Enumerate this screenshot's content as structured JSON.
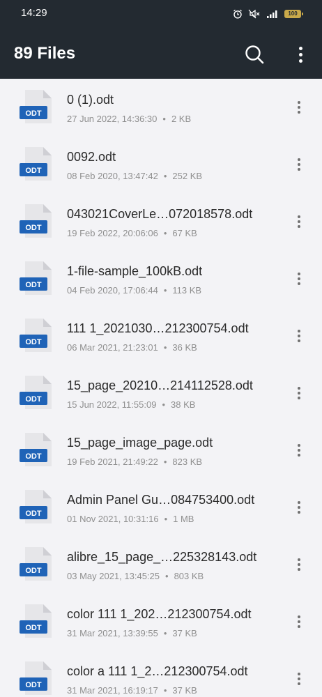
{
  "status_bar": {
    "time": "14:29",
    "battery": "100",
    "icons": [
      "alarm-icon",
      "mute-icon",
      "signal-icon",
      "battery-icon"
    ]
  },
  "header": {
    "title": "89 Files",
    "search_icon": "search-icon",
    "menu_icon": "overflow-menu-icon"
  },
  "file_badge": "ODT",
  "files": [
    {
      "name": "0 (1).odt",
      "date": "27 Jun 2022, 14:36:30",
      "size": "2 KB"
    },
    {
      "name": "0092.odt",
      "date": "08 Feb 2020, 13:47:42",
      "size": "252 KB"
    },
    {
      "name": "043021CoverLe…072018578.odt",
      "date": "19 Feb 2022, 20:06:06",
      "size": "67 KB"
    },
    {
      "name": "1-file-sample_100kB.odt",
      "date": "04 Feb 2020, 17:06:44",
      "size": "113 KB"
    },
    {
      "name": "111 1_2021030…212300754.odt",
      "date": "06 Mar 2021, 21:23:01",
      "size": "36 KB"
    },
    {
      "name": "15_page_20210…214112528.odt",
      "date": "15 Jun 2022, 11:55:09",
      "size": "38 KB"
    },
    {
      "name": "15_page_image_page.odt",
      "date": "19 Feb 2021, 21:49:22",
      "size": "823 KB"
    },
    {
      "name": "Admin Panel Gu…084753400.odt",
      "date": "01 Nov 2021, 10:31:16",
      "size": "1 MB"
    },
    {
      "name": "alibre_15_page_…225328143.odt",
      "date": "03 May 2021, 13:45:25",
      "size": "803 KB"
    },
    {
      "name": "color 111 1_202…212300754.odt",
      "date": "31 Mar 2021, 13:39:55",
      "size": "37 KB"
    },
    {
      "name": "color a 111 1_2…212300754.odt",
      "date": "31 Mar 2021, 16:19:17",
      "size": "37 KB"
    }
  ],
  "meta_separator": "•",
  "colors": {
    "header_bg": "#232a31",
    "list_bg": "#f3f3f6",
    "badge_blue": "#1f63b7",
    "battery": "#c9a94a"
  }
}
